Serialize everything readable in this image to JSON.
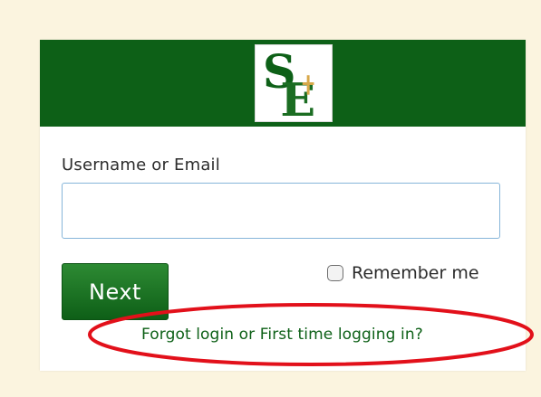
{
  "logo": {
    "alt_letters": "SE",
    "icon": "school-logo-icon"
  },
  "form": {
    "username_label": "Username or Email",
    "username_value": "",
    "username_placeholder": "",
    "next_label": "Next",
    "remember_label": "Remember me",
    "remember_checked": false,
    "forgot_link": "Forgot login or First time logging in?"
  },
  "colors": {
    "brand_green": "#0d6017",
    "page_background": "#fbf4df",
    "input_border": "#86b5d9",
    "annotation_red": "#e2101a",
    "logo_gold": "#d8a84a"
  }
}
